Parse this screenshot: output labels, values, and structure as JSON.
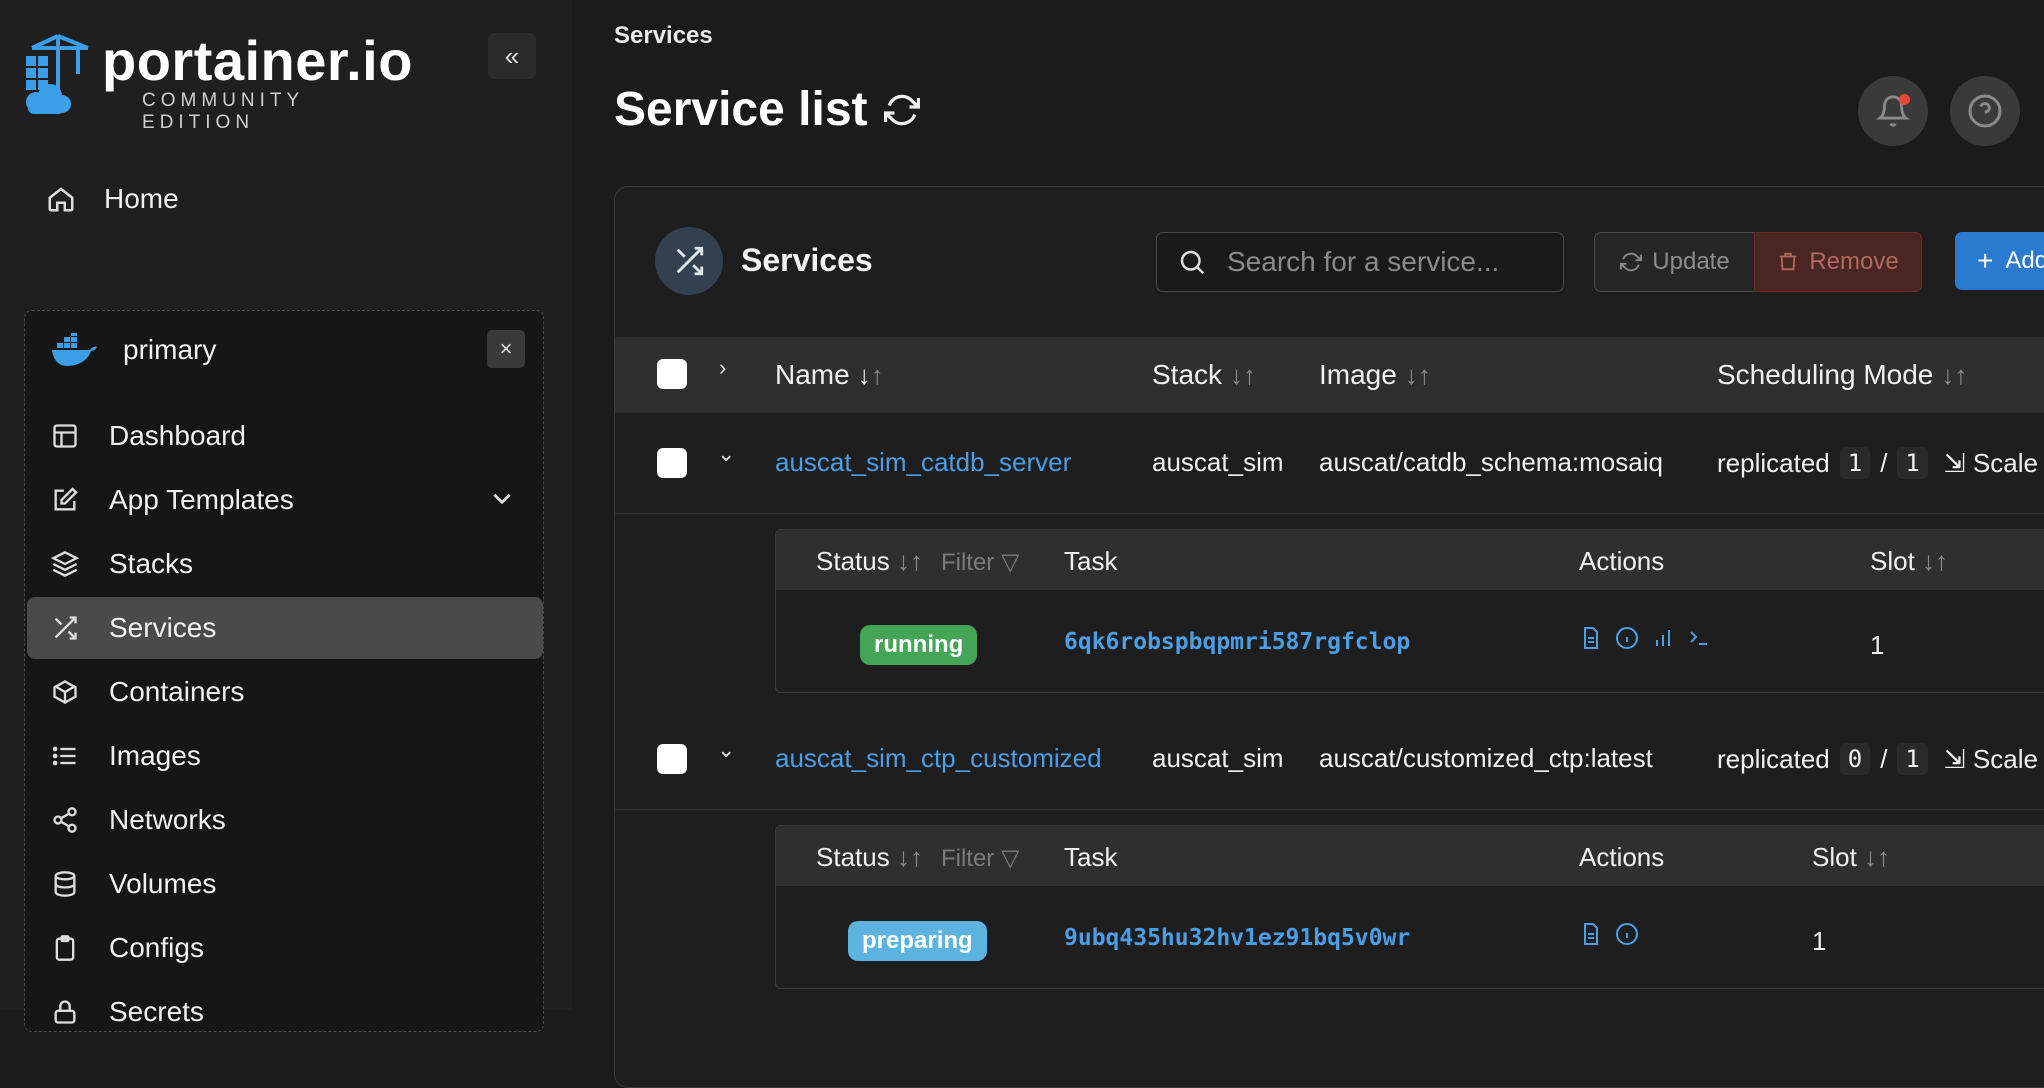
{
  "app": {
    "logo_word": "portainer.io",
    "logo_sub": "COMMUNITY EDITION",
    "collapse_icon": "«"
  },
  "sidebar": {
    "home_label": "Home",
    "environment": {
      "name": "primary",
      "close_icon": "×"
    },
    "items": [
      {
        "label": "Dashboard",
        "icon": "dashboard-icon"
      },
      {
        "label": "App Templates",
        "icon": "edit-icon",
        "expandable": true
      },
      {
        "label": "Stacks",
        "icon": "layers-icon"
      },
      {
        "label": "Services",
        "icon": "shuffle-icon",
        "active": true
      },
      {
        "label": "Containers",
        "icon": "box-icon"
      },
      {
        "label": "Images",
        "icon": "list-icon"
      },
      {
        "label": "Networks",
        "icon": "share-icon"
      },
      {
        "label": "Volumes",
        "icon": "database-icon"
      },
      {
        "label": "Configs",
        "icon": "clipboard-icon"
      },
      {
        "label": "Secrets",
        "icon": "lock-icon"
      }
    ]
  },
  "header": {
    "breadcrumb": "Services",
    "title": "Service list"
  },
  "panel": {
    "title": "Services",
    "search_placeholder": "Search for a service...",
    "update_label": "Update",
    "remove_label": "Remove",
    "add_label": "Add",
    "columns": {
      "name": "Name",
      "stack": "Stack",
      "image": "Image",
      "scheduling": "Scheduling Mode"
    },
    "scale_label": "Scale",
    "sort_arrows": "↓↑"
  },
  "services": [
    {
      "name": "auscat_sim_catdb_server",
      "stack": "auscat_sim",
      "image": "auscat/catdb_schema:mosaiq",
      "mode": "replicated",
      "running": "1",
      "sep": "/",
      "desired": "1",
      "tasks_header": {
        "status": "Status",
        "filter": "Filter",
        "task": "Task",
        "actions": "Actions",
        "slot": "Slot"
      },
      "task": {
        "status": "running",
        "status_color": "#45a557",
        "id": "6qk6robspbqpmri587rgfclop",
        "slot": "1",
        "actions": [
          "logs-icon",
          "info-icon",
          "stats-icon",
          "console-icon"
        ]
      }
    },
    {
      "name": "auscat_sim_ctp_customized",
      "stack": "auscat_sim",
      "image": "auscat/customized_ctp:latest",
      "mode": "replicated",
      "running": "0",
      "sep": "/",
      "desired": "1",
      "tasks_header": {
        "status": "Status",
        "filter": "Filter",
        "task": "Task",
        "actions": "Actions",
        "slot": "Slot"
      },
      "task": {
        "status": "preparing",
        "status_color": "#5db3e0",
        "id": "9ubq435hu32hv1ez91bq5v0wr",
        "slot": "1",
        "actions": [
          "logs-icon",
          "info-icon"
        ]
      }
    }
  ],
  "colors": {
    "accent": "#2a7ad0",
    "link": "#4a9ee6",
    "danger": "#4a2623",
    "notification_dot": "#e5483a"
  }
}
